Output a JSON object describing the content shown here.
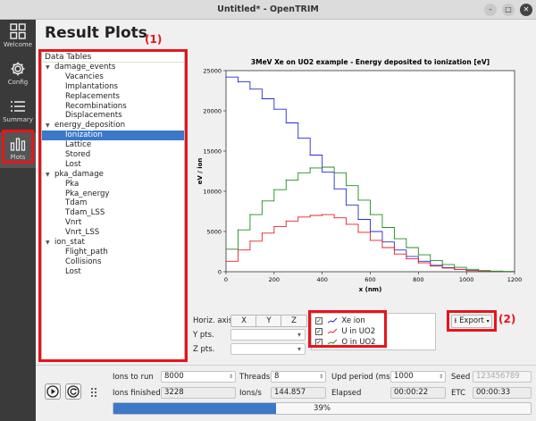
{
  "window": {
    "title": "Untitled* - OpenTRIM"
  },
  "sidebar": {
    "items": [
      {
        "label": "Welcome",
        "icon": "grid-icon"
      },
      {
        "label": "Config",
        "icon": "gear-icon"
      },
      {
        "label": "Summary",
        "icon": "list-icon"
      },
      {
        "label": "Plots",
        "icon": "bar-chart-icon"
      }
    ]
  },
  "page": {
    "title": "Result Plots"
  },
  "annotations": {
    "a1": "(1)",
    "a2": "(2)"
  },
  "tree": {
    "header": "Data Tables",
    "nodes": [
      {
        "label": "damage_events",
        "level": 0
      },
      {
        "label": "Vacancies",
        "level": 1
      },
      {
        "label": "Implantations",
        "level": 1
      },
      {
        "label": "Replacements",
        "level": 1
      },
      {
        "label": "Recombinations",
        "level": 1
      },
      {
        "label": "Displacements",
        "level": 1
      },
      {
        "label": "energy_deposition",
        "level": 0
      },
      {
        "label": "Ionization",
        "level": 1,
        "selected": true
      },
      {
        "label": "Lattice",
        "level": 1
      },
      {
        "label": "Stored",
        "level": 1
      },
      {
        "label": "Lost",
        "level": 1
      },
      {
        "label": "pka_damage",
        "level": 0
      },
      {
        "label": "Pka",
        "level": 1
      },
      {
        "label": "Pka_energy",
        "level": 1
      },
      {
        "label": "Tdam",
        "level": 1
      },
      {
        "label": "Tdam_LSS",
        "level": 1
      },
      {
        "label": "Vnrt",
        "level": 1
      },
      {
        "label": "Vnrt_LSS",
        "level": 1
      },
      {
        "label": "ion_stat",
        "level": 0
      },
      {
        "label": "Flight_path",
        "level": 1
      },
      {
        "label": "Collisions",
        "level": 1
      },
      {
        "label": "Lost",
        "level": 1
      }
    ]
  },
  "chart_data": {
    "type": "line",
    "title": "3MeV Xe on UO2 example - Energy deposited to ionization [eV]",
    "xlabel": "x (nm)",
    "ylabel": "eV / ion",
    "xlim": [
      0,
      1200
    ],
    "ylim": [
      0,
      25000
    ],
    "xticks": [
      0,
      200,
      400,
      600,
      800,
      1000,
      1200
    ],
    "yticks": [
      0,
      5000,
      10000,
      15000,
      20000,
      25000
    ],
    "x": [
      0,
      50,
      100,
      150,
      200,
      250,
      300,
      350,
      400,
      450,
      500,
      550,
      600,
      650,
      700,
      750,
      800,
      850,
      900,
      950,
      1000,
      1050,
      1100,
      1150,
      1200
    ],
    "series": [
      {
        "name": "Xe ion",
        "color": "#2b2bd9",
        "values": [
          24200,
          23600,
          22700,
          21500,
          20200,
          18500,
          16600,
          14500,
          12400,
          10300,
          8300,
          6500,
          5000,
          3700,
          2700,
          1900,
          1300,
          800,
          500,
          300,
          150,
          80,
          40,
          20,
          0
        ]
      },
      {
        "name": "U in UO2",
        "color": "#e0242a",
        "values": [
          1300,
          2700,
          3800,
          4800,
          5600,
          6300,
          6800,
          7000,
          7100,
          6700,
          5900,
          4900,
          3900,
          3000,
          2200,
          1600,
          1100,
          700,
          450,
          280,
          150,
          80,
          40,
          20,
          0
        ]
      },
      {
        "name": "O in UO2",
        "color": "#1f8f1f",
        "values": [
          2800,
          5200,
          7100,
          8800,
          10200,
          11400,
          12300,
          12900,
          13000,
          12300,
          10700,
          8900,
          7100,
          5500,
          4100,
          3000,
          2100,
          1400,
          900,
          550,
          300,
          150,
          70,
          30,
          0
        ]
      }
    ],
    "grid": false,
    "legend": "none"
  },
  "controls": {
    "horiz_axis_label": "Horiz. axis",
    "axis_buttons": [
      "X",
      "Y",
      "Z"
    ],
    "ypts_label": "Y pts.",
    "zpts_label": "Z pts.",
    "export_label": "Export"
  },
  "run": {
    "ions_to_run_label": "Ions to run",
    "ions_to_run": "8000",
    "threads_label": "Threads",
    "threads": "8",
    "upd_period_label": "Upd period (ms)",
    "upd_period": "1000",
    "seed_label": "Seed",
    "seed": "123456789",
    "ions_finished_label": "Ions finished",
    "ions_finished": "3228",
    "ions_s_label": "Ions/s",
    "ions_s": "144.857",
    "elapsed_label": "Elapsed",
    "elapsed": "00:00:22",
    "etc_label": "ETC",
    "etc": "00:00:33",
    "progress_label": "39%",
    "progress": 0.39
  }
}
